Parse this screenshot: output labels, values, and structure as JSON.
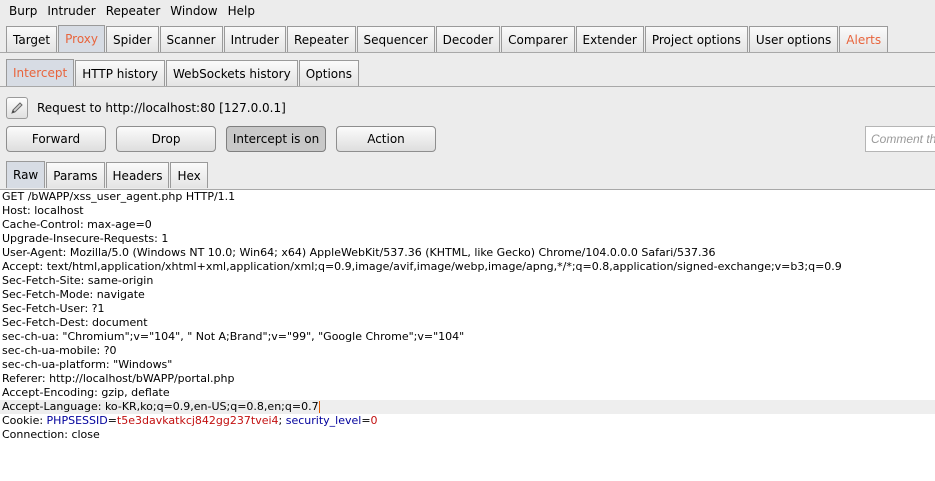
{
  "menubar": [
    "Burp",
    "Intruder",
    "Repeater",
    "Window",
    "Help"
  ],
  "main_tabs": [
    {
      "label": "Target"
    },
    {
      "label": "Proxy"
    },
    {
      "label": "Spider"
    },
    {
      "label": "Scanner"
    },
    {
      "label": "Intruder"
    },
    {
      "label": "Repeater"
    },
    {
      "label": "Sequencer"
    },
    {
      "label": "Decoder"
    },
    {
      "label": "Comparer"
    },
    {
      "label": "Extender"
    },
    {
      "label": "Project options"
    },
    {
      "label": "User options"
    },
    {
      "label": "Alerts"
    }
  ],
  "main_tabs_selected": "Proxy",
  "proxy_tabs": [
    {
      "label": "Intercept"
    },
    {
      "label": "HTTP history"
    },
    {
      "label": "WebSockets history"
    },
    {
      "label": "Options"
    }
  ],
  "proxy_tabs_selected": "Intercept",
  "request_info": "Request to http://localhost:80  [127.0.0.1]",
  "buttons": {
    "forward": "Forward",
    "drop": "Drop",
    "intercept": "Intercept is on",
    "action": "Action"
  },
  "comment_placeholder": "Comment this item",
  "view_tabs": [
    {
      "label": "Raw"
    },
    {
      "label": "Params"
    },
    {
      "label": "Headers"
    },
    {
      "label": "Hex"
    }
  ],
  "view_tabs_selected": "Raw",
  "request_lines": [
    "GET /bWAPP/xss_user_agent.php HTTP/1.1",
    "Host: localhost",
    "Cache-Control: max-age=0",
    "Upgrade-Insecure-Requests: 1",
    "User-Agent: Mozilla/5.0 (Windows NT 10.0; Win64; x64) AppleWebKit/537.36 (KHTML, like Gecko) Chrome/104.0.0.0 Safari/537.36",
    "Accept: text/html,application/xhtml+xml,application/xml;q=0.9,image/avif,image/webp,image/apng,*/*;q=0.8,application/signed-exchange;v=b3;q=0.9",
    "Sec-Fetch-Site: same-origin",
    "Sec-Fetch-Mode: navigate",
    "Sec-Fetch-User: ?1",
    "Sec-Fetch-Dest: document",
    "sec-ch-ua: \"Chromium\";v=\"104\", \" Not A;Brand\";v=\"99\", \"Google Chrome\";v=\"104\"",
    "sec-ch-ua-mobile: ?0",
    "sec-ch-ua-platform: \"Windows\"",
    "Referer: http://localhost/bWAPP/portal.php",
    "Accept-Encoding: gzip, deflate",
    "Accept-Language: ko-KR,ko;q=0.9,en-US;q=0.8,en;q=0.7"
  ],
  "cookie_line": {
    "prefix": "Cookie: ",
    "key1": "PHPSESSID",
    "eq1": "=",
    "val1": "t5e3davkatkcj842gg237tvei4",
    "sep": "; ",
    "key2": "security_level",
    "eq2": "=",
    "val2": "0"
  },
  "last_line": "Connection: close",
  "highlighted_line_index": 15,
  "colors": {
    "accent": "#e8643c",
    "cookie_key": "#00009c",
    "cookie_value": "#c21010"
  }
}
